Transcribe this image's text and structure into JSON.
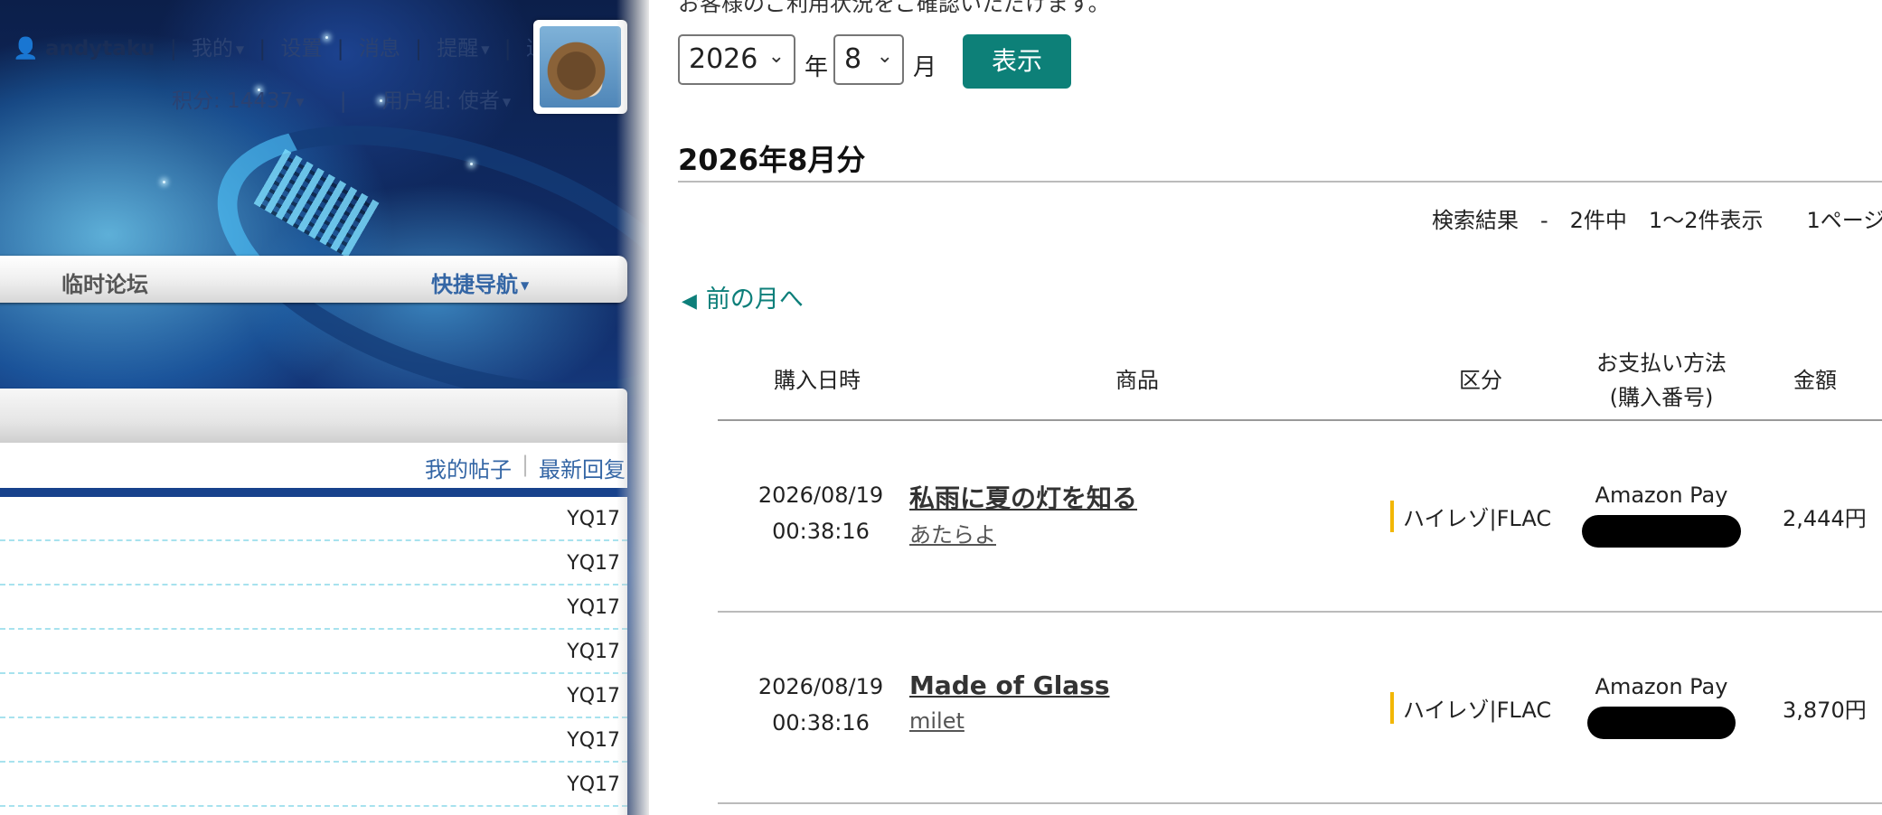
{
  "forum": {
    "user": {
      "name": "andytaku",
      "menu": [
        "我的",
        "设置",
        "消息",
        "提醒",
        "退出"
      ],
      "points_label": "积分: 14437",
      "group_label": "用户组: 使者"
    },
    "nav": {
      "temp_forum": "临时论坛",
      "quick_nav": "快捷导航"
    },
    "links": {
      "my_posts": "我的帖子",
      "latest_reply": "最新回复"
    },
    "rows": [
      "YQ17",
      "YQ17",
      "YQ17",
      "YQ17",
      "YQ17",
      "YQ17",
      "YQ17"
    ]
  },
  "purchase": {
    "cut_text": "お客様のご利用状況をご確認いただけます。",
    "filter": {
      "year": "2026",
      "year_unit": "年",
      "month": "8",
      "month_unit": "月",
      "show_button": "表示"
    },
    "heading": "2026年8月分",
    "results": "検索結果　-　2件中　1〜2件表示　　1ページ",
    "prev_month": "前の月へ",
    "columns": {
      "date": "購入日時",
      "item": "商品",
      "category": "区分",
      "payment_line1": "お支払い方法",
      "payment_line2": "(購入番号)",
      "amount": "金額"
    },
    "orders": [
      {
        "date": "2026/08/19",
        "time": "00:38:16",
        "title": "私雨に夏の灯を知る",
        "artist": "あたらよ",
        "category": "ハイレゾ|FLAC",
        "payment": "Amazon Pay",
        "amount": "2,444円"
      },
      {
        "date": "2026/08/19",
        "time": "00:38:16",
        "title": "Made of Glass",
        "artist": "milet",
        "category": "ハイレゾ|FLAC",
        "payment": "Amazon Pay",
        "amount": "3,870円"
      }
    ]
  },
  "colors": {
    "accent": "#0d8078",
    "forum_link": "#3466a5",
    "category_marker": "#f2b705"
  }
}
